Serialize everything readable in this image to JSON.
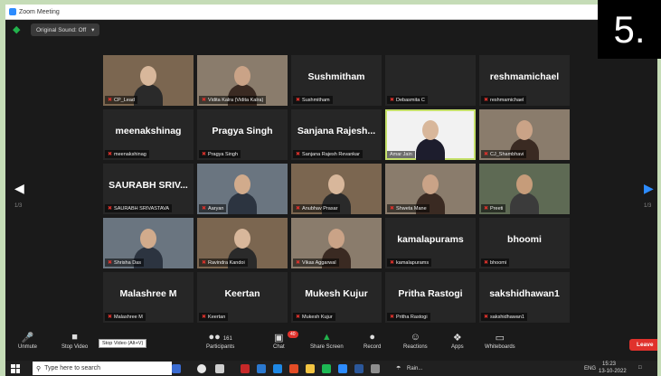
{
  "window": {
    "title": "Zoom Meeting"
  },
  "topbar": {
    "original_sound": "Original Sound: Off",
    "caret": "▾"
  },
  "badge": "5.",
  "pagination": {
    "left": "1/3",
    "right": "1/3"
  },
  "tiles": [
    {
      "name": "CP_Lead",
      "big": "",
      "video": true,
      "muted": true
    },
    {
      "name": "Vidita Kalra (Vidita Kalra)",
      "big": "",
      "video": true,
      "muted": true
    },
    {
      "name": "Sushmitham",
      "big": "Sushmitham",
      "video": false,
      "muted": true
    },
    {
      "name": "Debasmita C",
      "big": "",
      "video": false,
      "muted": true
    },
    {
      "name": "reshmamichael",
      "big": "reshmamichael",
      "video": false,
      "muted": true
    },
    {
      "name": "meenakshinag",
      "big": "meenakshinag",
      "video": false,
      "muted": true
    },
    {
      "name": "Pragya Singh",
      "big": "Pragya Singh",
      "video": false,
      "muted": true
    },
    {
      "name": "Sanjana Rajesh Revankar",
      "big": "Sanjana Rajesh...",
      "video": false,
      "muted": true
    },
    {
      "name": "Amar Jain",
      "big": "",
      "video": true,
      "muted": false,
      "active": true
    },
    {
      "name": "CJ_Shambhavi",
      "big": "",
      "video": true,
      "muted": true
    },
    {
      "name": "SAURABH SRIVASTAVA",
      "big": "SAURABH SRIV...",
      "video": false,
      "muted": true
    },
    {
      "name": "Aaryan",
      "big": "",
      "video": true,
      "muted": true
    },
    {
      "name": "Anubhav Prasar",
      "big": "",
      "video": true,
      "muted": true
    },
    {
      "name": "Shweta Mane",
      "big": "",
      "video": true,
      "muted": true
    },
    {
      "name": "Preeti",
      "big": "",
      "video": true,
      "muted": true
    },
    {
      "name": "Shrisha Das",
      "big": "",
      "video": true,
      "muted": true
    },
    {
      "name": "Ravindra Kandoi",
      "big": "",
      "video": true,
      "muted": true
    },
    {
      "name": "Vikas Aggarwal",
      "big": "",
      "video": true,
      "muted": true
    },
    {
      "name": "kamalapurams",
      "big": "kamalapurams",
      "video": false,
      "muted": true
    },
    {
      "name": "bhoomi",
      "big": "bhoomi",
      "video": false,
      "muted": true
    },
    {
      "name": "Malashree M",
      "big": "Malashree M",
      "video": false,
      "muted": true
    },
    {
      "name": "Keertan",
      "big": "Keertan",
      "video": false,
      "muted": true
    },
    {
      "name": "Mukesh Kujur",
      "big": "Mukesh Kujur",
      "video": false,
      "muted": true
    },
    {
      "name": "Pritha Rastogi",
      "big": "Pritha Rastogi",
      "video": false,
      "muted": true
    },
    {
      "name": "sakshidhawan1",
      "big": "sakshidhawan1",
      "video": false,
      "muted": true
    }
  ],
  "toolbar": {
    "unmute": "Unmute",
    "stop_video": "Stop Video",
    "tooltip": "Stop Video (Alt+V)",
    "participants": "Participants",
    "participants_count": "161",
    "chat": "Chat",
    "chat_badge": "40",
    "share_screen": "Share Screen",
    "record": "Record",
    "reactions": "Reactions",
    "apps": "Apps",
    "whiteboards": "Whiteboards",
    "leave": "Leave"
  },
  "taskbar": {
    "search_placeholder": "Type here to search",
    "weather": "Rain...",
    "lang": "ENG",
    "time": "15:23",
    "date": "13-10-2022"
  }
}
